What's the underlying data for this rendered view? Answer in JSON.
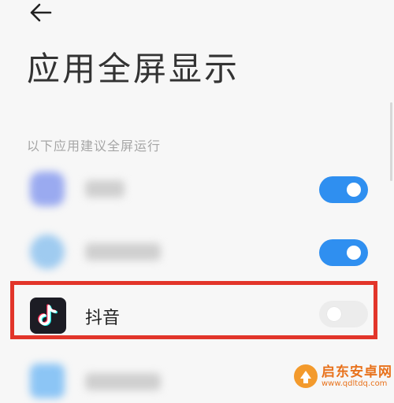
{
  "header": {
    "back_icon": "arrow-left-icon",
    "title": "应用全屏显示"
  },
  "section": {
    "label": "以下应用建议全屏运行"
  },
  "apps": [
    {
      "name": "",
      "icon": "blurred-app-icon",
      "fullscreen": true
    },
    {
      "name": "",
      "icon": "blurred-app-icon",
      "fullscreen": true
    },
    {
      "name": "抖音",
      "icon": "tiktok-icon",
      "fullscreen": false
    },
    {
      "name": "",
      "icon": "blurred-app-icon",
      "fullscreen": false
    }
  ],
  "colors": {
    "toggle_on": "#2f8ff0",
    "toggle_off": "#ececec",
    "highlight_border": "#e2352a"
  },
  "watermark": {
    "title": "启东安卓网",
    "url": "www.qdltdq.com"
  }
}
